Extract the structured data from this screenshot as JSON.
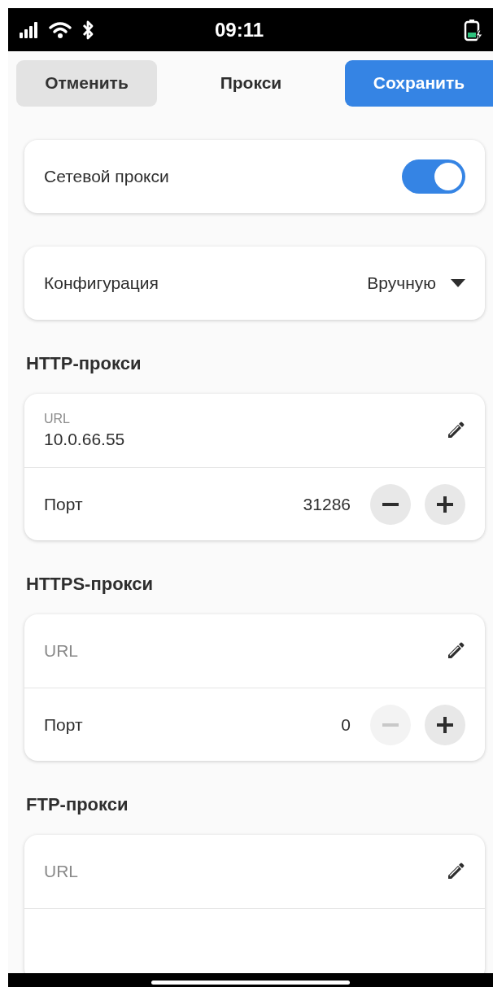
{
  "status_bar": {
    "time": "09:11"
  },
  "header": {
    "cancel": "Отменить",
    "title": "Прокси",
    "save": "Сохранить"
  },
  "proxy_switch": {
    "label": "Сетевой прокси",
    "on": true
  },
  "configuration": {
    "label": "Конфигурация",
    "value": "Вручную"
  },
  "sections": [
    {
      "title": "HTTP-прокси",
      "url": {
        "label": "URL",
        "value": "10.0.66.55"
      },
      "port": {
        "label": "Порт",
        "value": "31286",
        "minus_disabled": false,
        "plus_disabled": false
      }
    },
    {
      "title": "HTTPS-прокси",
      "url": {
        "placeholder": "URL"
      },
      "port": {
        "label": "Порт",
        "value": "0",
        "minus_disabled": true,
        "plus_disabled": false
      }
    },
    {
      "title": "FTP-прокси",
      "url": {
        "placeholder": "URL"
      }
    }
  ]
}
